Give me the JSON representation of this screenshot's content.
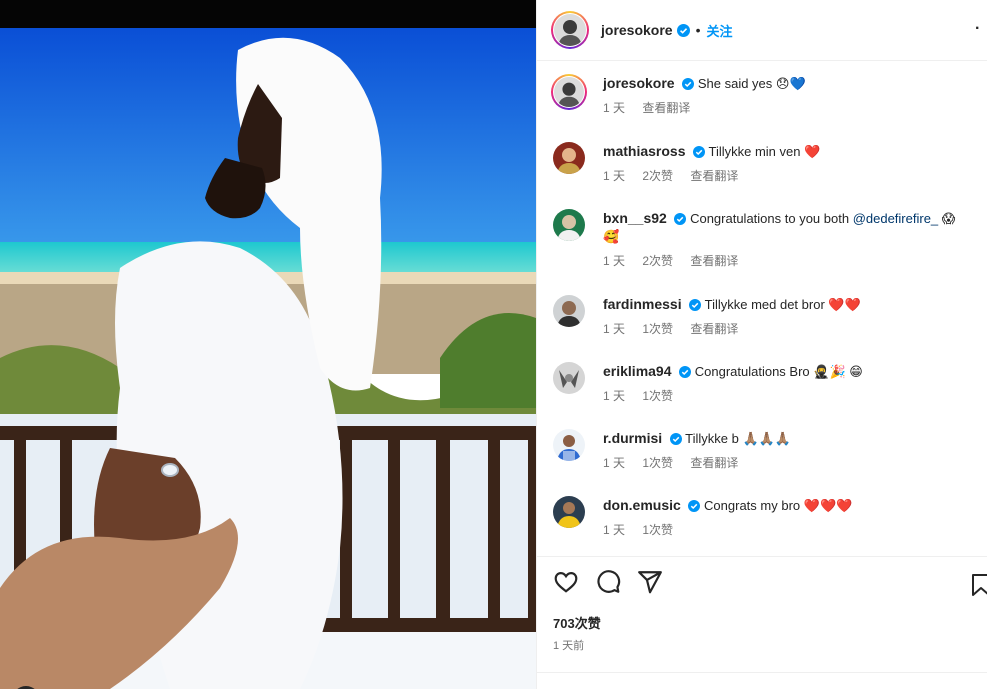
{
  "post": {
    "username": "joresokore",
    "separator": "•",
    "follow_label": "关注",
    "more_label": "·"
  },
  "comments": [
    {
      "username": "joresokore",
      "text": "She said yes 😞",
      "emoji": "💙",
      "time": "1 天",
      "likes": "",
      "translate": "查看翻译"
    },
    {
      "username": "mathiasross",
      "text": "Tillykke min ven",
      "emoji": "❤️",
      "time": "1 天",
      "likes": "2次赞",
      "translate": "查看翻译"
    },
    {
      "username": "bxn__s92",
      "text": "Congratulations to you both ",
      "mention": "@dedefirefire_",
      "emoji": " 😱",
      "emoji2": "🥰",
      "time": "1 天",
      "likes": "2次赞",
      "translate": "查看翻译"
    },
    {
      "username": "fardinmessi",
      "text": "Tillykke med det bror",
      "emoji": "❤️❤️",
      "time": "1 天",
      "likes": "1次赞",
      "translate": "查看翻译"
    },
    {
      "username": "eriklima94",
      "text": "Congratulations Bro",
      "emoji": "🥷🎉 😁",
      "time": "1 天",
      "likes": "1次赞",
      "translate": ""
    },
    {
      "username": "r.durmisi",
      "text": "Tillykke b",
      "emoji": "🙏🏽🙏🏽🙏🏽",
      "time": "1 天",
      "likes": "1次赞",
      "translate": "查看翻译"
    },
    {
      "username": "don.emusic",
      "text": "Congrats my bro",
      "emoji": "❤️❤️❤️",
      "time": "1 天",
      "likes": "1次赞",
      "translate": ""
    }
  ],
  "footer": {
    "likes": "703次赞",
    "ago": "1 天前"
  },
  "icons": [
    "heart-icon",
    "comment-icon",
    "share-icon",
    "bookmark-icon",
    "user-tag-icon",
    "verified-badge-icon"
  ],
  "colors": {
    "accent": "#0095f6",
    "verified": "#0095f6",
    "heart": "#e0142d",
    "muted": "#737373"
  }
}
